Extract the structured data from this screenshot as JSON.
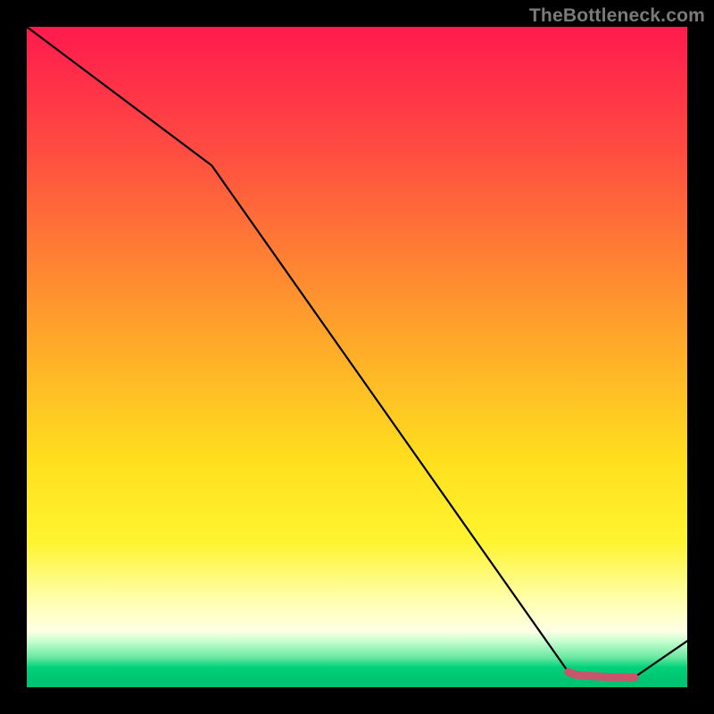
{
  "watermark": "TheBottleneck.com",
  "chart_data": {
    "type": "line",
    "title": "",
    "xlabel": "",
    "ylabel": "",
    "xlim": [
      0,
      100
    ],
    "ylim": [
      0,
      100
    ],
    "series": [
      {
        "name": "primary-curve",
        "x": [
          0,
          28,
          82,
          92,
          100
        ],
        "values": [
          100,
          79,
          2.3,
          1.5,
          7
        ]
      },
      {
        "name": "highlight-segment",
        "x": [
          82,
          83,
          85,
          87,
          89,
          91,
          92
        ],
        "values": [
          2.3,
          1.9,
          1.7,
          1.6,
          1.5,
          1.5,
          1.5
        ]
      }
    ],
    "annotations": []
  },
  "colors": {
    "curve": "#000000",
    "highlight": "#c9546b",
    "bg_top": "#ff1a4d",
    "bg_bottom": "#00c471"
  }
}
